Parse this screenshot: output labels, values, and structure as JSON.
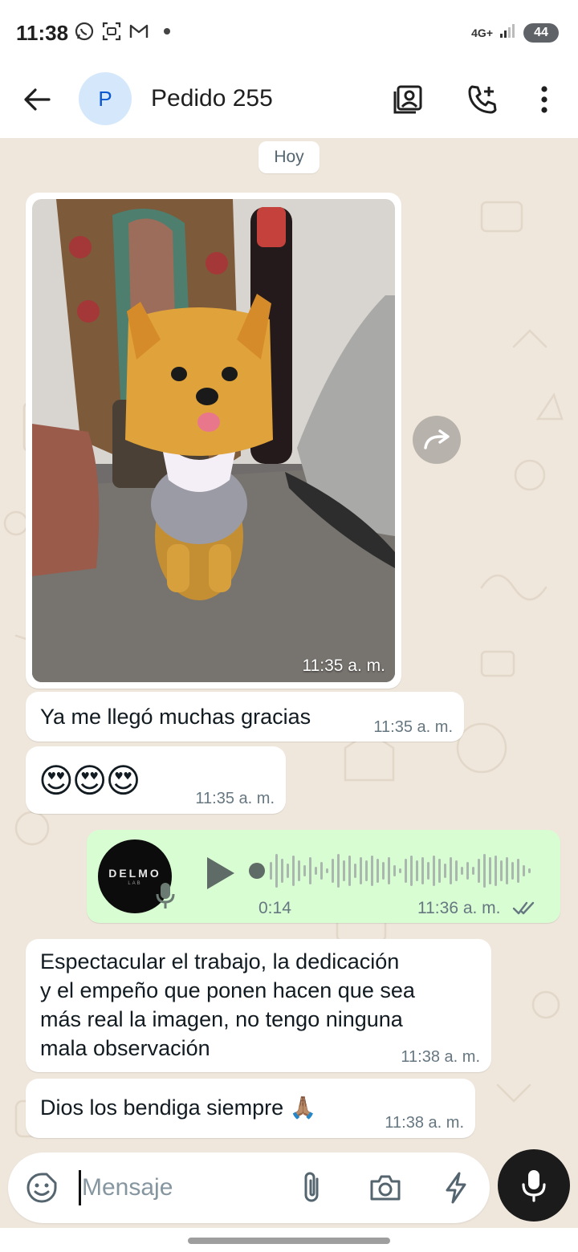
{
  "status_bar": {
    "time": "11:38",
    "network": "4G+",
    "battery": "44"
  },
  "header": {
    "avatar_letter": "P",
    "title": "Pedido 255"
  },
  "date_chip": "Hoy",
  "messages": [
    {
      "type": "image",
      "direction": "incoming",
      "time": "11:35 a. m."
    },
    {
      "type": "text",
      "direction": "incoming",
      "text": "Ya me llegó muchas gracias",
      "time": "11:35 a. m."
    },
    {
      "type": "text",
      "direction": "incoming",
      "text": "😍😍😍",
      "time": "11:35 a. m."
    },
    {
      "type": "audio",
      "direction": "outgoing",
      "avatar_brand": "DELMO",
      "avatar_sub": "LAB",
      "duration": "0:14",
      "time": "11:36 a. m.",
      "status": "read"
    },
    {
      "type": "text",
      "direction": "incoming",
      "lines": [
        "Espectacular el trabajo, la dedicación",
        "y el empeño que ponen hacen que sea",
        "más real la imagen, no tengo ninguna",
        "mala observación"
      ],
      "time": "11:38 a. m."
    },
    {
      "type": "text",
      "direction": "incoming",
      "text": "Dios los bendiga siempre 🙏🏽",
      "time": "11:38 a. m."
    }
  ],
  "composer": {
    "placeholder": "Mensaje"
  },
  "colors": {
    "chat_background": "#efe7dc",
    "outgoing_bubble": "#d9fdd3",
    "incoming_bubble": "#ffffff",
    "read_ticks": "#53bdeb"
  }
}
